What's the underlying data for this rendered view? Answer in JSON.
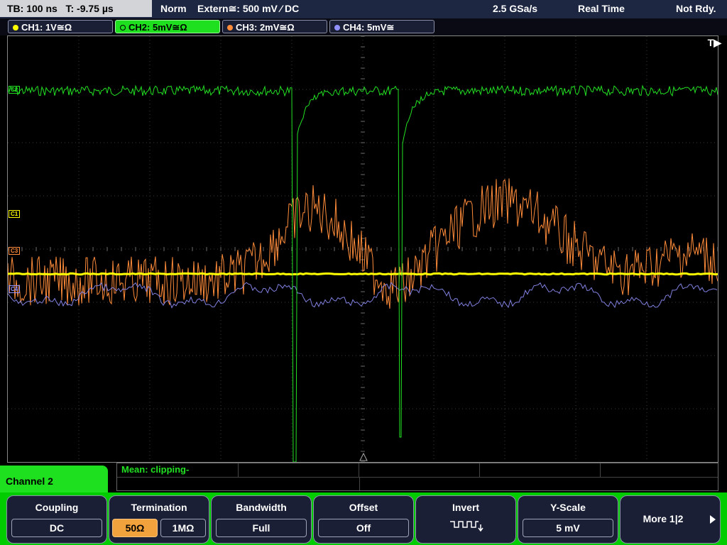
{
  "status_bar": {
    "timebase": "TB: 100 ns",
    "trigger_time": "T: -9.75 µs",
    "mode": "Norm",
    "trigger_source": "Extern≅: 500 mV ⁄ DC",
    "sample_rate": "2.5 GSa/s",
    "acquisition": "Real Time",
    "trigger_status": "Not Rdy."
  },
  "channels": [
    {
      "label": "CH1: 1V≅Ω",
      "color": "#ffff00",
      "active": false
    },
    {
      "label": "CH2: 5mV≅Ω",
      "color": "#22e022",
      "active": true
    },
    {
      "label": "CH3: 2mV≅Ω",
      "color": "#ff8c3a",
      "active": false
    },
    {
      "label": "CH4: 5mV≅",
      "color": "#9090ff",
      "active": false
    }
  ],
  "display": {
    "trigger_marker": "T▶",
    "markers": [
      {
        "label": "C2",
        "color": "#22e022"
      },
      {
        "label": "C1",
        "color": "#ffff00"
      },
      {
        "label": "C3",
        "color": "#ff8c3a"
      },
      {
        "label": "C4",
        "color": "#9090ff"
      }
    ]
  },
  "measurement": {
    "label": "Mean: clipping-"
  },
  "panel": {
    "title": "Channel 2"
  },
  "softkeys": {
    "coupling": {
      "label": "Coupling",
      "value": "DC"
    },
    "termination": {
      "label": "Termination",
      "option_50": "50Ω",
      "option_1m": "1MΩ",
      "selected": "50Ω"
    },
    "bandwidth": {
      "label": "Bandwidth",
      "value": "Full"
    },
    "offset": {
      "label": "Offset",
      "value": "Off"
    },
    "invert": {
      "label": "Invert",
      "icon": "invert-pulse-icon"
    },
    "yscale": {
      "label": "Y-Scale",
      "value": "5 mV"
    },
    "more": {
      "label": "More 1|2",
      "icon": "arrow-right-icon"
    }
  }
}
